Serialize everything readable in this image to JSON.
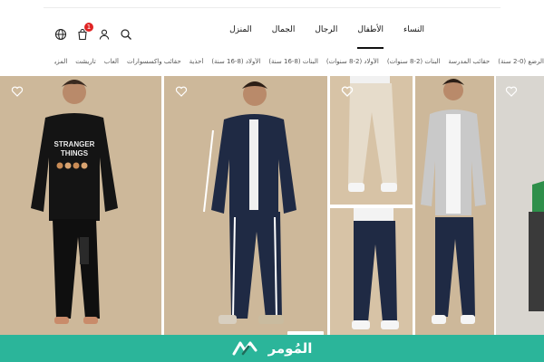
{
  "header": {
    "main_nav": [
      {
        "label": "النساء",
        "active": false
      },
      {
        "label": "الأطفال",
        "active": true
      },
      {
        "label": "الرجال",
        "active": false
      },
      {
        "label": "الجمال",
        "active": false
      },
      {
        "label": "المنزل",
        "active": false
      }
    ],
    "cart_count": "1",
    "icons": [
      "language-icon",
      "cart-icon",
      "user-icon",
      "search-icon"
    ]
  },
  "sub_nav": [
    "الرضع (0-2 سنة)",
    "حقائب المدرسة",
    "البنات (2-8 سنوات)",
    "الأولاد (2-8 سنوات)",
    "البنات (8-16 سنة)",
    "الأولاد (8-16 سنة)",
    "أحذية",
    "حقائب واكسسوارات",
    "ألعاب",
    "تاريشت",
    "المزيد"
  ],
  "products": {
    "print_text": "STRANGER THINGS",
    "accent_colors": {
      "beige": "#cdb89a",
      "navy": "#1f2a44",
      "black": "#111111",
      "grey_hoodie": "#c9c9c9"
    }
  },
  "banner": {
    "brand": "المُومر",
    "color": "#2bb59a"
  }
}
